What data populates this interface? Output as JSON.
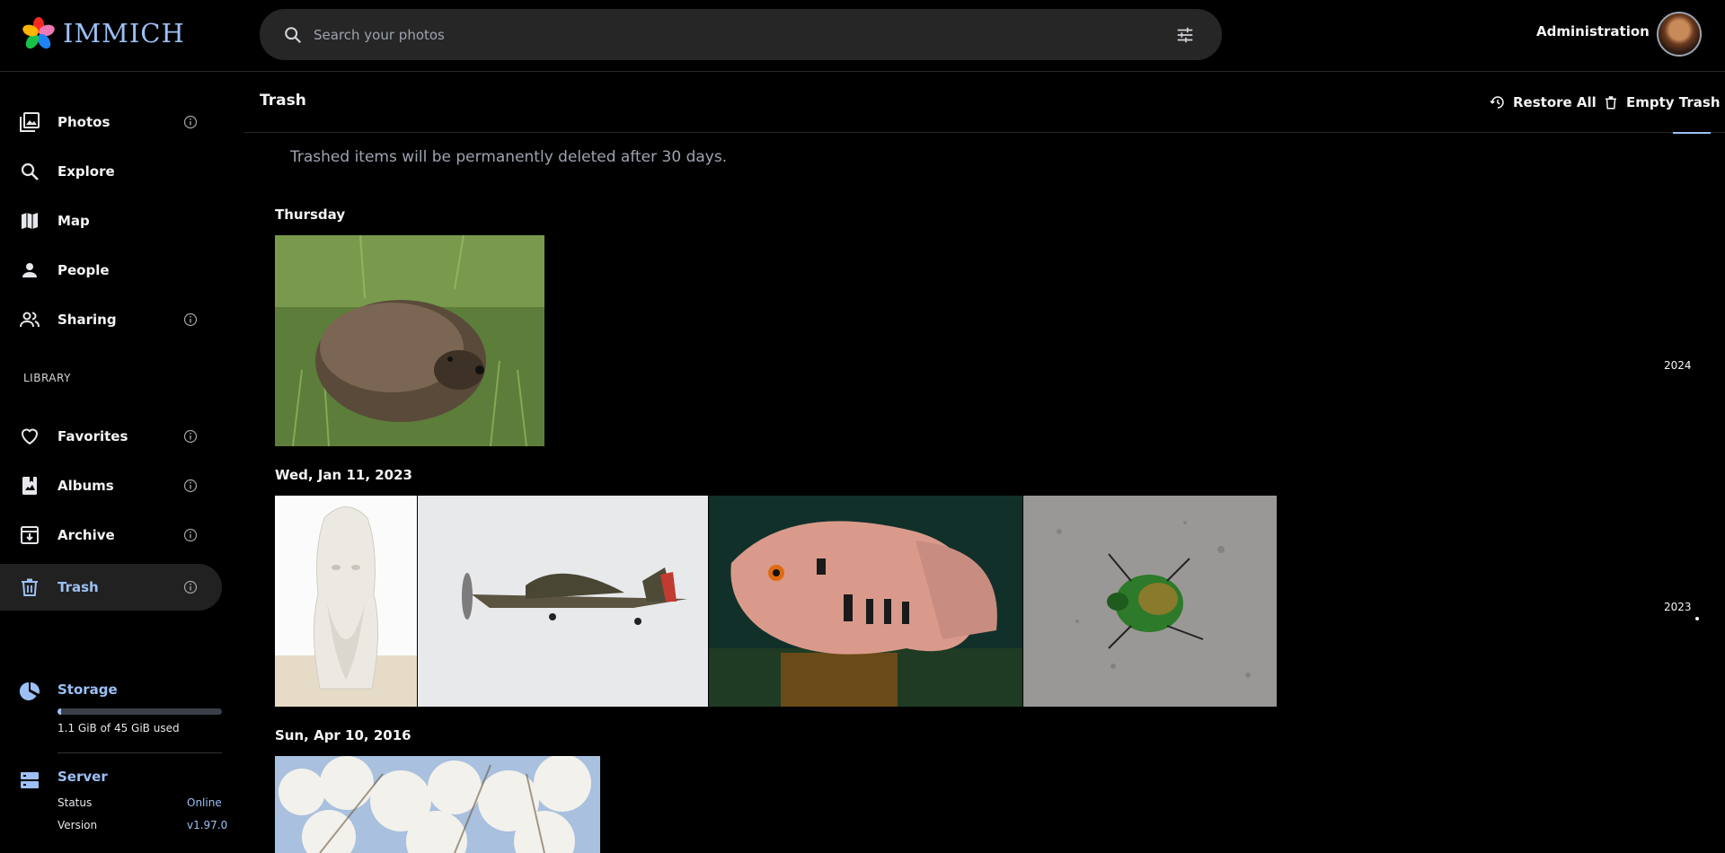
{
  "app": {
    "name": "IMMICH"
  },
  "search": {
    "placeholder": "Search your photos"
  },
  "header": {
    "admin_label": "Administration"
  },
  "sidebar": {
    "items": [
      {
        "label": "Photos"
      },
      {
        "label": "Explore"
      },
      {
        "label": "Map"
      },
      {
        "label": "People"
      },
      {
        "label": "Sharing"
      },
      {
        "label": "Favorites"
      },
      {
        "label": "Albums"
      },
      {
        "label": "Archive"
      },
      {
        "label": "Trash",
        "active": true
      }
    ],
    "library_label": "LIBRARY"
  },
  "storage": {
    "title": "Storage",
    "usage_text": "1.1 GiB of 45 GiB used",
    "used_fraction": 0.024
  },
  "server": {
    "title": "Server",
    "status_label": "Status",
    "status_value": "Online",
    "version_label": "Version",
    "version_value": "v1.97.0"
  },
  "page": {
    "title": "Trash",
    "restore_all": "Restore All",
    "empty_trash": "Empty Trash",
    "notice": "Trashed items will be permanently deleted after 30 days."
  },
  "groups": [
    {
      "date": "Thursday",
      "photos": [
        "hedgehog"
      ]
    },
    {
      "date": "Wed, Jan 11, 2023",
      "photos": [
        "bust sculpture",
        "hurricane aircraft",
        "cichlid fish",
        "green beetle"
      ]
    },
    {
      "date": "Sun, Apr 10, 2016",
      "photos": [
        "blossoming tree"
      ]
    }
  ],
  "timeline": {
    "years": [
      "2024",
      "2023"
    ]
  },
  "colors": {
    "accent": "#9cc0f5",
    "background": "#000000",
    "search_bg": "#262626"
  }
}
